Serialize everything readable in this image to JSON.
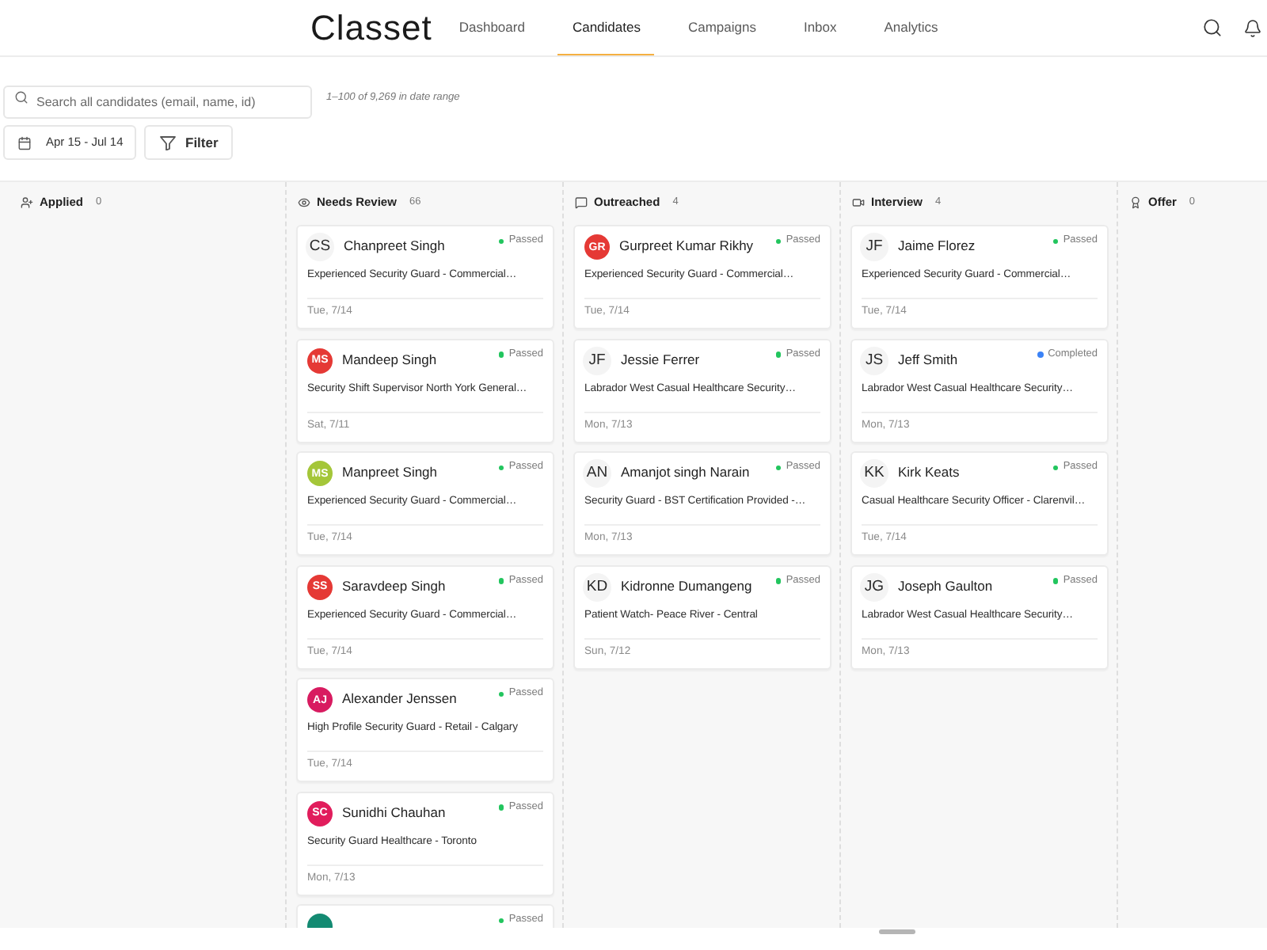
{
  "header": {
    "logo": "Classet",
    "nav": [
      {
        "label": "Dashboard",
        "selected": false
      },
      {
        "label": "Candidates",
        "selected": true
      },
      {
        "label": "Campaigns",
        "selected": false
      },
      {
        "label": "Inbox",
        "selected": false
      },
      {
        "label": "Analytics",
        "selected": false
      }
    ]
  },
  "toolbar": {
    "search": {
      "placeholder": "Search all candidates (email, name, id)"
    },
    "range_summary": "1–100 of 9,269 in date range",
    "date_range": "Apr 15 - Jul 14",
    "filter": "Filter"
  },
  "columns": [
    {
      "kind": "applied",
      "title": "Applied",
      "count": "0"
    },
    {
      "kind": "review",
      "title": "Needs Review",
      "count": "66",
      "cards": [
        {
          "avatar": {
            "initials": "CS"
          },
          "name": "Chanpreet Singh",
          "status": {
            "label": "Passed",
            "color": "#22c55e"
          },
          "job": "Experienced Security Guard - Commercial…",
          "date": "Tue, 7/14"
        },
        {
          "avatar": {
            "initials": "MS",
            "color": "#e53935"
          },
          "name": "Mandeep Singh",
          "status": {
            "label": "Passed",
            "color": "#22c55e"
          },
          "job": "Security Shift Supervisor North York General…",
          "date": "Sat, 7/11"
        },
        {
          "avatar": {
            "initials": "MS",
            "color": "#a4c639"
          },
          "name": "Manpreet Singh",
          "status": {
            "label": "Passed",
            "color": "#22c55e"
          },
          "job": "Experienced Security Guard - Commercial…",
          "date": "Tue, 7/14"
        },
        {
          "avatar": {
            "initials": "SS",
            "color": "#e53935"
          },
          "name": "Saravdeep Singh",
          "status": {
            "label": "Passed",
            "color": "#22c55e"
          },
          "job": "Experienced Security Guard - Commercial…",
          "date": "Tue, 7/14"
        },
        {
          "avatar": {
            "initials": "AJ",
            "color": "#d81b60"
          },
          "name": "Alexander Jenssen",
          "status": {
            "label": "Passed",
            "color": "#22c55e"
          },
          "job": "High Profile Security Guard - Retail - Calgary",
          "date": "Tue, 7/14"
        },
        {
          "avatar": {
            "initials": "SC",
            "color": "#e11d5c"
          },
          "name": "Sunidhi Chauhan",
          "status": {
            "label": "Passed",
            "color": "#22c55e"
          },
          "job": "Security Guard Healthcare - Toronto",
          "date": "Mon, 7/13"
        },
        {
          "avatar": {
            "color": "#138a72"
          },
          "status": {
            "label": "Passed",
            "color": "#22c55e"
          }
        }
      ]
    },
    {
      "kind": "outreach",
      "title": "Outreached",
      "count": "4",
      "cards": [
        {
          "avatar": {
            "initials": "GR",
            "color": "#e53935"
          },
          "name": "Gurpreet Kumar Rikhy",
          "status": {
            "label": "Passed",
            "color": "#22c55e"
          },
          "job": "Experienced Security Guard - Commercial…",
          "date": "Tue, 7/14"
        },
        {
          "avatar": {
            "initials": "JF"
          },
          "name": "Jessie Ferrer",
          "status": {
            "label": "Passed",
            "color": "#22c55e"
          },
          "job": "Labrador West Casual Healthcare Security…",
          "date": "Mon, 7/13"
        },
        {
          "avatar": {
            "initials": "AN"
          },
          "name": "Amanjot singh Narain",
          "status": {
            "label": "Passed",
            "color": "#22c55e"
          },
          "job": "Security Guard - BST Certification Provided -…",
          "date": "Mon, 7/13"
        },
        {
          "avatar": {
            "initials": "KD"
          },
          "name": "Kidronne Dumangeng",
          "status": {
            "label": "Passed",
            "color": "#22c55e"
          },
          "job": "Patient Watch- Peace River - Central",
          "date": "Sun, 7/12"
        }
      ]
    },
    {
      "kind": "interview",
      "title": "Interview",
      "count": "4",
      "cards": [
        {
          "avatar": {
            "initials": "JF"
          },
          "name": "Jaime Florez",
          "status": {
            "label": "Passed",
            "color": "#22c55e"
          },
          "job": "Experienced Security Guard - Commercial…",
          "date": "Tue, 7/14"
        },
        {
          "avatar": {
            "initials": "JS"
          },
          "name": "Jeff Smith",
          "status": {
            "label": "Completed",
            "color": "#3b82f6"
          },
          "job": "Labrador West Casual Healthcare Security…",
          "date": "Mon, 7/13"
        },
        {
          "avatar": {
            "initials": "KK"
          },
          "name": "Kirk Keats",
          "status": {
            "label": "Passed",
            "color": "#22c55e"
          },
          "job": "Casual Healthcare Security Officer - Clarenvil…",
          "date": "Tue, 7/14"
        },
        {
          "avatar": {
            "initials": "JG"
          },
          "name": "Joseph Gaulton",
          "status": {
            "label": "Passed",
            "color": "#22c55e"
          },
          "job": "Labrador West Casual Healthcare Security…",
          "date": "Mon, 7/13"
        }
      ]
    },
    {
      "kind": "offer",
      "title": "Offer",
      "count": "0"
    }
  ]
}
